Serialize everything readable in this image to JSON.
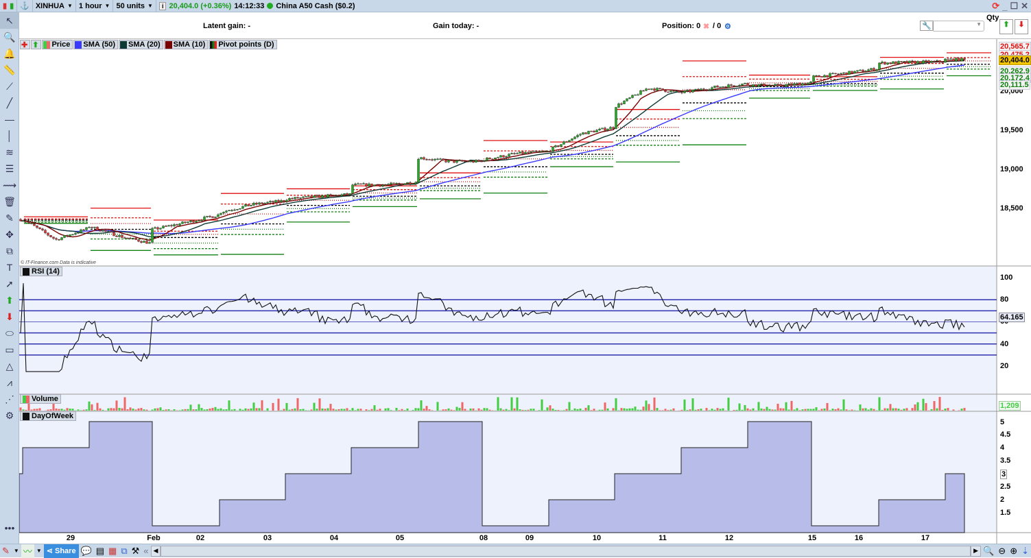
{
  "topbar": {
    "symbol": "XINHUA",
    "interval": "1 hour",
    "units": "50 units",
    "price_change": "20,404.0 (+0.36%)",
    "time": "14:12:33",
    "instrument": "China A50 Cash ($0.2)",
    "qty_label": "Qty",
    "change_color": "#1a9a1a"
  },
  "infobar": {
    "latent_gain": "Latent gain: -",
    "gain_today": "Gain today: -",
    "position": "Position: 0",
    "position_extra": "/ 0"
  },
  "legend": [
    {
      "label": "Price",
      "color": "#e06060"
    },
    {
      "label": "SMA (50)",
      "color": "#3a3aff"
    },
    {
      "label": "SMA (20)",
      "color": "#0e3a36"
    },
    {
      "label": "SMA (10)",
      "color": "#7a0000"
    },
    {
      "label": "Pivot points (D)",
      "color": "#1a7a1a"
    }
  ],
  "copyright": "© IT-Finance.com  Data is indicative",
  "panels": {
    "rsi": "RSI (14)",
    "volume": "Volume",
    "dow": "DayOfWeek"
  },
  "axis": {
    "price_ticks": [
      "20,000",
      "19,500",
      "19,000",
      "18,500"
    ],
    "price_tags": {
      "r2": "20,565.7",
      "r1": "20,475.2",
      "last": "20,404.0",
      "s1": "20,262.9",
      "s2": "20,172.4",
      "s3": "20,111.5"
    },
    "rsi_ticks": [
      "100",
      "80",
      "60",
      "40",
      "20"
    ],
    "rsi_last": "64.165",
    "volume_last": "1,209",
    "dow_ticks": [
      "5",
      "4.5",
      "4",
      "3.5",
      "3",
      "2.5",
      "2",
      "1.5"
    ],
    "dates": [
      "29",
      "Feb",
      "02",
      "03",
      "04",
      "05",
      "08",
      "09",
      "10",
      "11",
      "12",
      "15",
      "16",
      "17"
    ]
  },
  "bottombar": {
    "share": "Share"
  },
  "chart_data": {
    "type": "candlestick",
    "price_ylim": [
      18000,
      20600
    ],
    "sessions": [
      {
        "day": "Wed",
        "dow": 3,
        "closes": [
          18360
        ]
      },
      {
        "day": "Thu",
        "dow": 4,
        "closes": [
          18360,
          18100,
          18250
        ]
      },
      {
        "day": "Fri",
        "dow": 5,
        "closes": [
          18270,
          18140,
          18050
        ]
      },
      {
        "day": "Mon",
        "dow": 1,
        "closes": [
          18230,
          18320,
          18420
        ]
      },
      {
        "day": "Tue",
        "dow": 2,
        "closes": [
          18450,
          18550,
          18600
        ]
      },
      {
        "day": "Wed",
        "dow": 3,
        "closes": [
          18620,
          18650,
          18680
        ]
      },
      {
        "day": "Thu",
        "dow": 4,
        "closes": [
          18800,
          18800,
          18840
        ]
      },
      {
        "day": "Fri",
        "dow": 5,
        "closes": [
          19150,
          19100,
          19100
        ]
      },
      {
        "day": "Mon",
        "dow": 1,
        "closes": [
          19120,
          19200,
          19230
        ]
      },
      {
        "day": "Tue",
        "dow": 2,
        "closes": [
          19240,
          19460,
          19540
        ]
      },
      {
        "day": "Wed",
        "dow": 3,
        "closes": [
          19800,
          20040,
          19980
        ]
      },
      {
        "day": "Thu",
        "dow": 4,
        "closes": [
          19980,
          20050,
          20100
        ]
      },
      {
        "day": "Fri",
        "dow": 5,
        "closes": [
          20080,
          20070,
          20110
        ]
      },
      {
        "day": "Mon",
        "dow": 1,
        "closes": [
          20180,
          20230,
          20290
        ]
      },
      {
        "day": "Tue",
        "dow": 2,
        "closes": [
          20360,
          20370,
          20380
        ]
      },
      {
        "day": "Wed",
        "dow": 3,
        "closes": [
          20404
        ]
      }
    ],
    "rsi_levels": [
      80,
      70,
      60,
      50,
      40,
      30
    ],
    "rsi_ylim": [
      0,
      100
    ],
    "dow_ylim": [
      1,
      5
    ],
    "colors": {
      "up": "#22aa22",
      "down": "#dd3333",
      "sma50": "#3a3aff",
      "sma20": "#0e3a36",
      "sma10": "#7a0000",
      "pivot_r": "#e01010",
      "pivot_p": "#000000",
      "pivot_s": "#108010",
      "rsi_level": "#3030b0",
      "dow_fill": "#b8bce8"
    }
  }
}
